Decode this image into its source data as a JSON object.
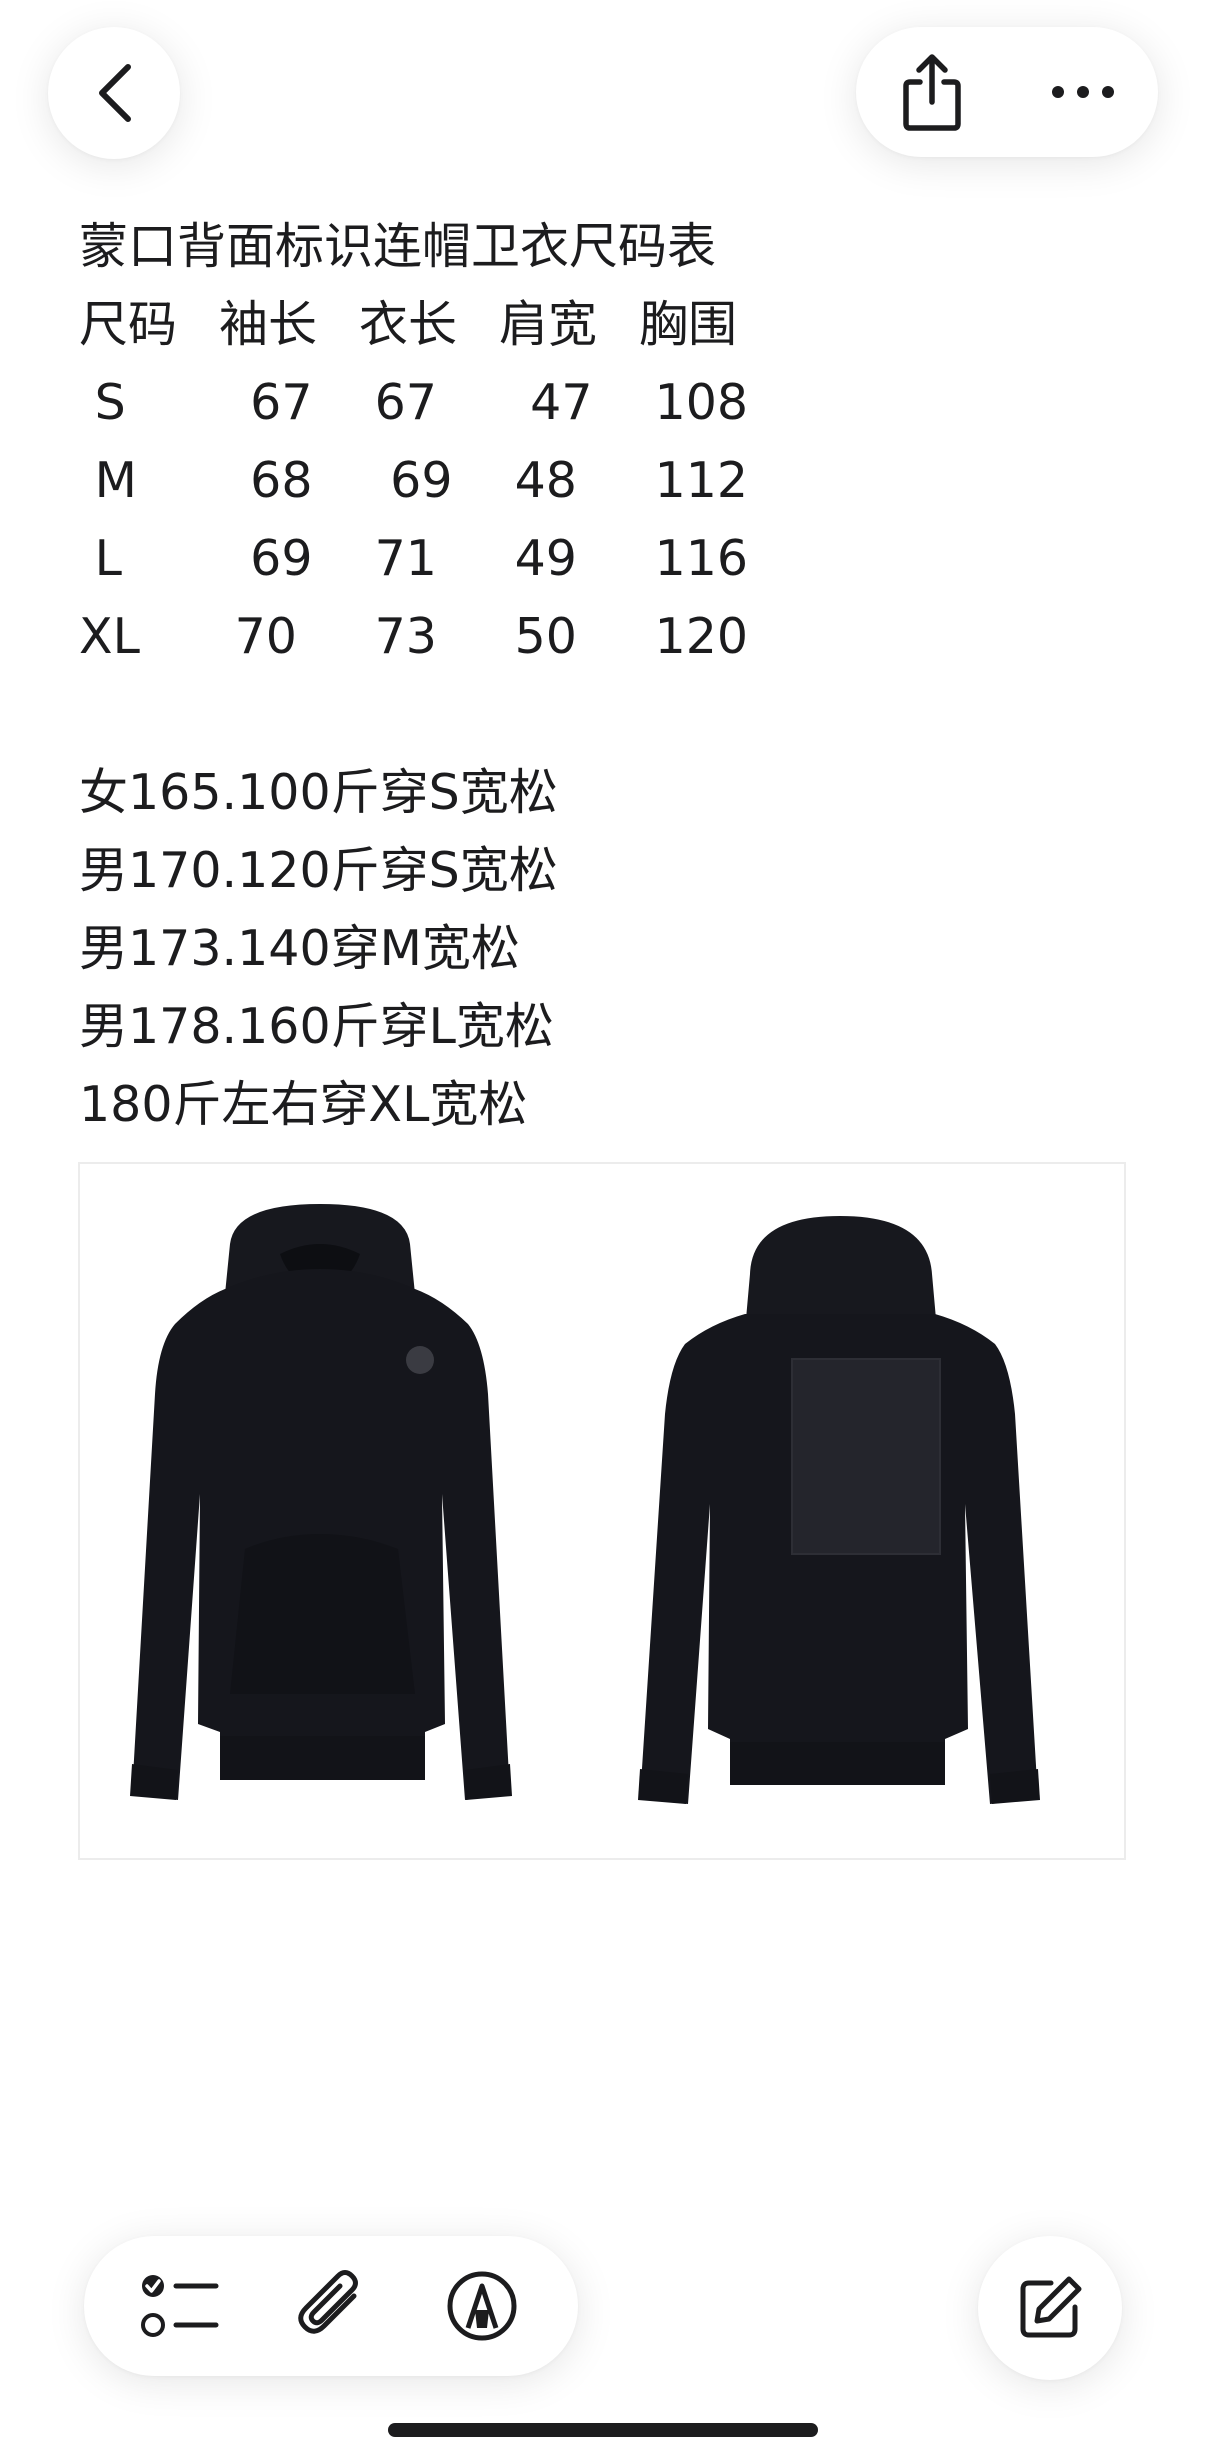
{
  "toolbar_top": {
    "back_icon": "chevron-left-icon",
    "share_icon": "share-icon",
    "more_icon": "ellipsis-icon"
  },
  "note": {
    "title": "蒙口背面标识连帽卫衣尺码表",
    "table": {
      "headers": [
        "尺码",
        "袖长",
        "衣长",
        "肩宽",
        "胸围"
      ],
      "rows": [
        [
          " S",
          "  67",
          " 67",
          "  47",
          " 108"
        ],
        [
          " M",
          "  68",
          "  69",
          " 48",
          " 112"
        ],
        [
          " L",
          "  69",
          " 71",
          " 49",
          " 116"
        ],
        [
          "XL",
          " 70",
          " 73",
          " 50",
          " 120"
        ]
      ]
    },
    "fit_lines": [
      "女165.100斤穿S宽松",
      "男170.120斤穿S宽松",
      "男173.140穿M宽松",
      "男178.160斤穿L宽松",
      "180斤左右穿XL宽松"
    ]
  },
  "attachment": {
    "type": "product-photo",
    "hoodie_color": "#15161c"
  },
  "toolbar_bottom": {
    "checklist_icon": "checklist-icon",
    "attach_icon": "paperclip-icon",
    "markup_icon": "markup-pen-icon",
    "compose_icon": "compose-icon"
  }
}
